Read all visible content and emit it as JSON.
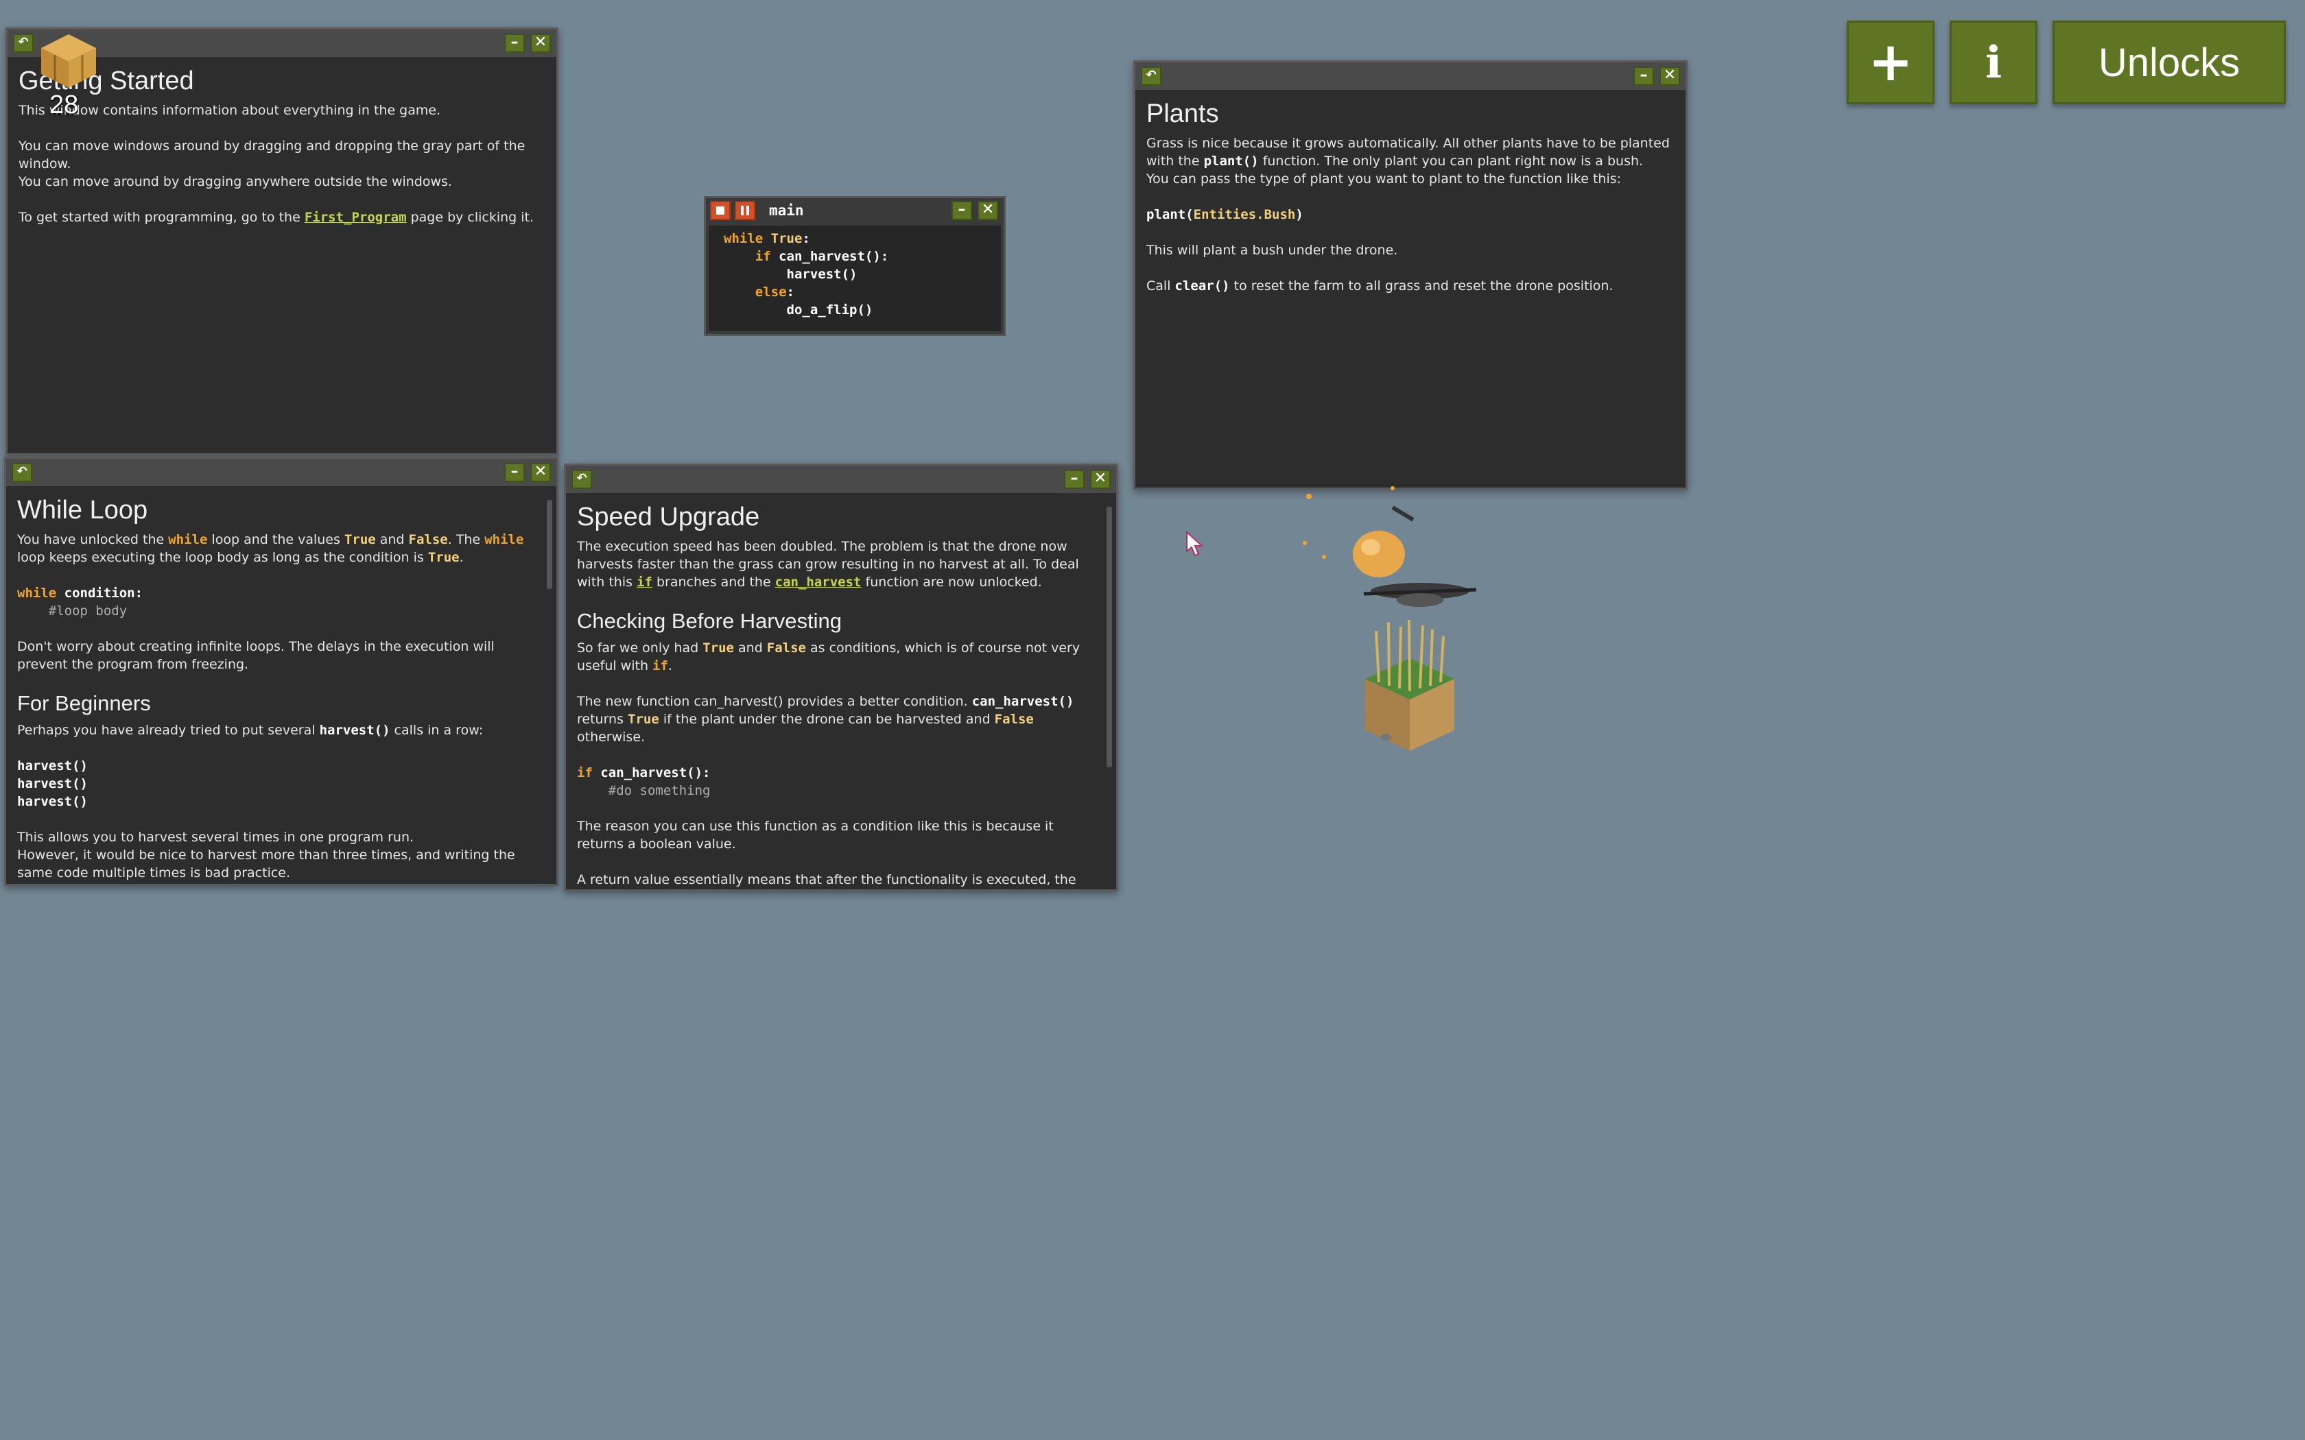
{
  "resource_counter": {
    "icon": "hay-bale-icon",
    "value": "28"
  },
  "top_buttons": {
    "add_label": "+",
    "info_label": "i",
    "unlocks_label": "Unlocks"
  },
  "getting_started": {
    "title": "Getting Started",
    "p1": "This window contains information about everything in the game.",
    "p2a": "You can move windows around by dragging and dropping the gray part of the window.",
    "p2b": "You can move around by dragging anywhere outside the windows.",
    "p3_before": "To get started with programming, go to the ",
    "p3_link": "First_Program",
    "p3_after": " page by clicking it."
  },
  "while_loop": {
    "title": "While Loop",
    "p1": [
      "You have unlocked the ",
      "while",
      " loop and the values ",
      "True",
      " and ",
      "False",
      ". The ",
      "while",
      " loop keeps executing the loop body as long as the condition is ",
      "True",
      "."
    ],
    "code1": [
      "while",
      " condition:",
      "#loop body"
    ],
    "p2": "Don't worry about creating infinite loops. The delays in the execution will prevent the program from freezing.",
    "h2": "For Beginners",
    "p3": [
      "Perhaps you have already tried to put several ",
      "harvest()",
      " calls in a row:"
    ],
    "code2": [
      "harvest()",
      "harvest()",
      "harvest()"
    ],
    "p4a": "This allows you to harvest several times in one program run.",
    "p4b": "However, it would be nice to harvest more than three times, and writing the same code multiple times is bad practice."
  },
  "main_code": {
    "title": "main",
    "lines": [
      "while True:",
      "if can_harvest():",
      "harvest()",
      "else:",
      "do_a_flip()"
    ]
  },
  "speed_upgrade": {
    "title": "Speed Upgrade",
    "p1": [
      "The execution speed has been doubled. The problem is that the drone now harvests faster than the grass can grow resulting in no harvest at all. To deal with this ",
      "if",
      " branches and the ",
      "can_harvest",
      " function are now unlocked."
    ],
    "h2": "Checking Before Harvesting",
    "p2": [
      "So far we only had ",
      "True",
      " and ",
      "False",
      " as conditions, which is of course not very useful with ",
      "if",
      "."
    ],
    "p3": [
      "The new function can_harvest() provides a better condition. ",
      "can_harvest()",
      " returns ",
      "True",
      " if the plant under the drone can be harvested and ",
      "False",
      " otherwise."
    ],
    "code": [
      "if",
      " can_harvest():",
      "#do something"
    ],
    "p4": "The reason you can use this function as a condition like this is because it returns a boolean value.",
    "p5": "A return value essentially means that after the functionality is executed, the function call expression evaluates to the returned value."
  },
  "plants": {
    "title": "Plants",
    "p1": [
      "Grass is nice because it grows automatically. All other plants have to be planted with the ",
      "plant()",
      " function. The only plant you can plant right now is a bush."
    ],
    "p1b": "You can pass the type of plant you want to plant to the function like this:",
    "code": [
      "plant(",
      "Entities.Bush",
      ")"
    ],
    "p2": "This will plant a bush under the drone.",
    "p3": [
      "Call ",
      "clear()",
      " to reset the farm to all grass and reset the drone position."
    ]
  }
}
